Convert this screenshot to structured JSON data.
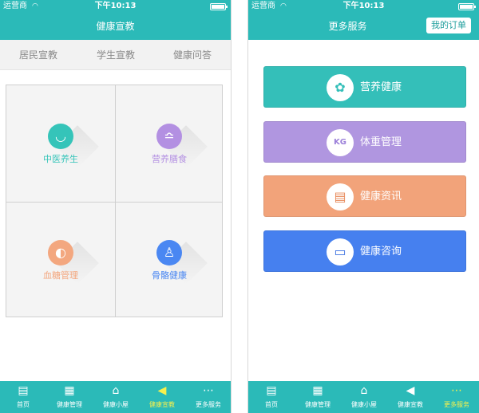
{
  "status_bar": {
    "carrier": "运营商",
    "wifi_icon": "◠",
    "time": "下午10:13"
  },
  "left": {
    "title": "健康宣教",
    "segments": [
      {
        "label": "居民宣教",
        "active": true
      },
      {
        "label": "学生宣教",
        "active": false
      },
      {
        "label": "健康问答",
        "active": false
      }
    ],
    "cells": [
      {
        "label": "中医养生",
        "icon": "bowl-icon",
        "glyph": "◡",
        "color": "#35c4b9"
      },
      {
        "label": "营养膳食",
        "icon": "dish-icon",
        "glyph": "≏",
        "color": "#b390e2"
      },
      {
        "label": "血糖管理",
        "icon": "drop-icon",
        "glyph": "◐",
        "color": "#f3a77f"
      },
      {
        "label": "骨骼健康",
        "icon": "bone-icon",
        "glyph": "♙",
        "color": "#4a87f2"
      }
    ]
  },
  "right": {
    "title": "更多服务",
    "orders_button": "我的订单",
    "cards": [
      {
        "label": "营养健康",
        "icon": "flower-icon",
        "glyph": "✿",
        "color": "#34bfb9",
        "icon_color": "#34bfb9"
      },
      {
        "label": "体重管理",
        "icon": "scale-icon",
        "glyph": "KG",
        "color": "#b096e0",
        "icon_color": "#9b7fd9"
      },
      {
        "label": "健康资讯",
        "icon": "news-icon",
        "glyph": "▤",
        "color": "#f2a37a",
        "icon_color": "#e8895a"
      },
      {
        "label": "健康咨询",
        "icon": "chat-icon",
        "glyph": "▭",
        "color": "#4680ef",
        "icon_color": "#3a6fe0"
      }
    ]
  },
  "tabbar": {
    "left": [
      {
        "label": "首页",
        "icon": "home-icon",
        "glyph": "▤"
      },
      {
        "label": "健康管理",
        "icon": "calendar-icon",
        "glyph": "▦"
      },
      {
        "label": "健康小屋",
        "icon": "house-icon",
        "glyph": "⌂"
      },
      {
        "label": "健康宣教",
        "icon": "megaphone-icon",
        "glyph": "◀"
      },
      {
        "label": "更多服务",
        "icon": "more-icon",
        "glyph": "⋯"
      }
    ],
    "right": [
      {
        "label": "首页",
        "icon": "home-icon",
        "glyph": "▤"
      },
      {
        "label": "健康管理",
        "icon": "calendar-icon",
        "glyph": "▦"
      },
      {
        "label": "健康小屋",
        "icon": "house-icon",
        "glyph": "⌂"
      },
      {
        "label": "健康宣教",
        "icon": "megaphone-icon",
        "glyph": "◀"
      },
      {
        "label": "更多服务",
        "icon": "more-icon",
        "glyph": "⋯"
      }
    ],
    "left_active": 3,
    "right_active": 4
  }
}
